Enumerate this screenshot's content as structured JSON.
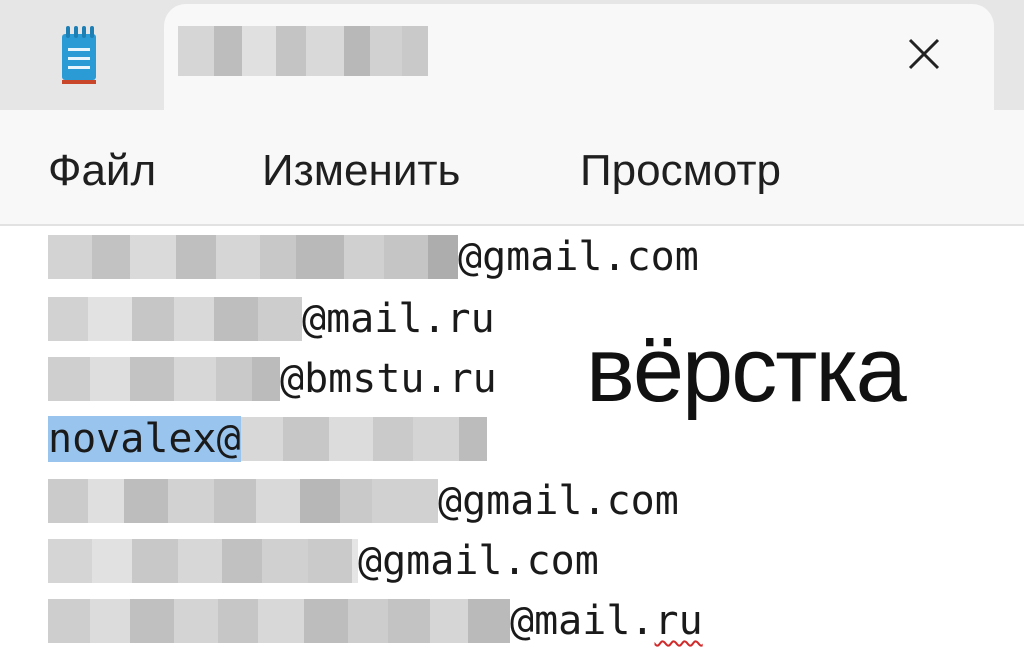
{
  "window": {
    "app_icon": "notepad-icon",
    "tab_close_icon": "close-icon"
  },
  "menu": {
    "file": "Файл",
    "edit": "Изменить",
    "view": "Просмотр"
  },
  "editor": {
    "lines": [
      {
        "suffix": "@gmail.com"
      },
      {
        "suffix": "@mail.ru"
      },
      {
        "suffix": "@bmstu.ru"
      },
      {
        "prefix_selected": "novalex@"
      },
      {
        "suffix": "@gmail.com"
      },
      {
        "suffix": "@gmail.com"
      },
      {
        "suffix_plain": "@mail.",
        "suffix_misspelled": "ru"
      }
    ]
  },
  "watermark": {
    "text": "вёрстка"
  },
  "colors": {
    "selection": "#99c4ee",
    "spellcheck": "#d12a2a",
    "icon_blue": "#2b9bd6"
  }
}
